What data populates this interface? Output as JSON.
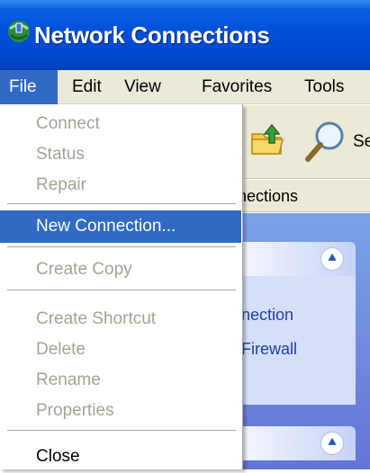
{
  "window": {
    "title": "Network Connections"
  },
  "menubar": {
    "items": [
      {
        "label": "File",
        "active": true
      },
      {
        "label": "Edit"
      },
      {
        "label": "View"
      },
      {
        "label": "Favorites"
      },
      {
        "label": "Tools"
      }
    ]
  },
  "toolbar": {
    "search_label_partial": "Se"
  },
  "address": {
    "text_partial": "nections"
  },
  "file_menu": {
    "items": [
      {
        "label": "Connect",
        "enabled": false
      },
      {
        "label": "Status",
        "enabled": false
      },
      {
        "label": "Repair",
        "enabled": false
      },
      {
        "label": "New Connection...",
        "enabled": true,
        "selected": true
      },
      {
        "label": "Create Copy",
        "enabled": false
      },
      {
        "label": "Create Shortcut",
        "enabled": false
      },
      {
        "label": "Delete",
        "enabled": false
      },
      {
        "label": "Rename",
        "enabled": false
      },
      {
        "label": "Properties",
        "enabled": false
      },
      {
        "label": "Close",
        "enabled": true
      }
    ]
  },
  "task_pane": {
    "links": [
      {
        "label": "nection"
      },
      {
        "label": "Firewall"
      }
    ]
  },
  "colors": {
    "titlebar": "#0050d8",
    "selection": "#316ac5",
    "menu_background": "#ece9d8",
    "disabled_text": "#a6a293",
    "task_pane": "#6375d6"
  },
  "icons": [
    "network-connections-icon",
    "folder-up-icon",
    "search-icon",
    "collapse-chevron-icon"
  ]
}
